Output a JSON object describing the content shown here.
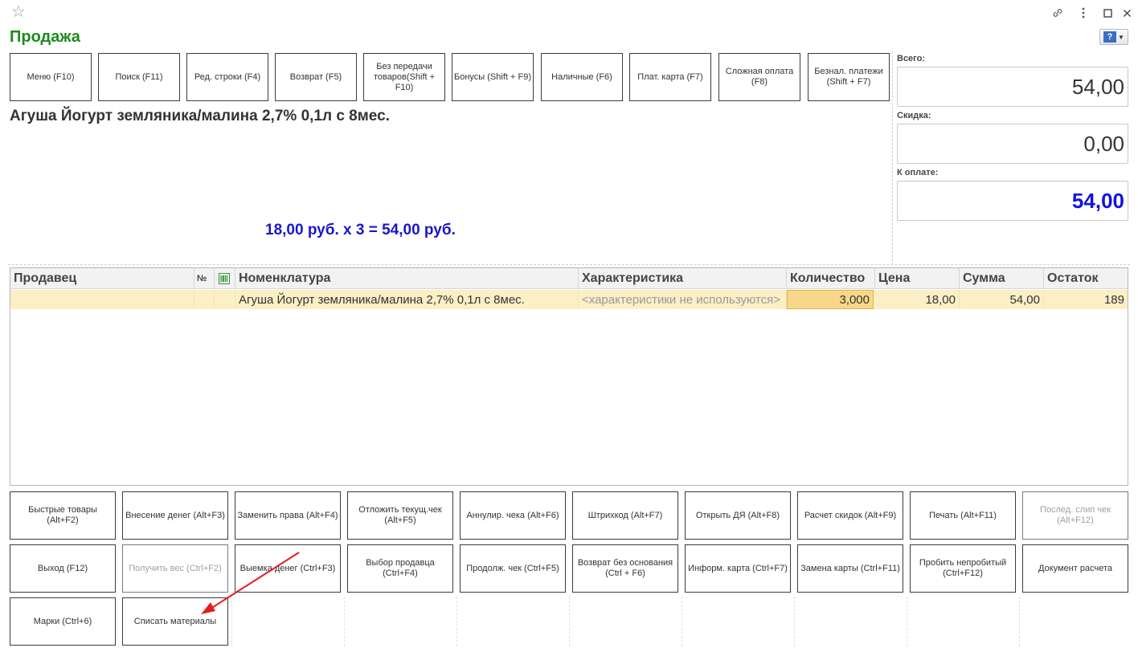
{
  "window": {
    "title": "Продажа"
  },
  "top_buttons": [
    "Меню (F10)",
    "Поиск (F11)",
    "Ред. строки (F4)",
    "Возврат (F5)",
    "Без передачи товаров(Shift + F10)",
    "Бонусы (Shift + F9)",
    "Наличные (F6)",
    "Плат. карта (F7)",
    "Сложная оплата (F8)",
    "Безнал. платежи (Shift + F7)"
  ],
  "totals": {
    "total_label": "Всего:",
    "total_value": "54,00",
    "discount_label": "Скидка:",
    "discount_value": "0,00",
    "pay_label": "К оплате:",
    "pay_value": "54,00"
  },
  "current_item": {
    "name": "Агуша Йогурт земляника/малина 2,7% 0,1л с 8мес.",
    "calc": "18,00 руб. x 3  = 54,00 руб."
  },
  "table": {
    "headers": [
      "Продавец",
      "№",
      "",
      "Номенклатура",
      "Характеристика",
      "Количество",
      "Цена",
      "Сумма",
      "Остаток"
    ],
    "rows": [
      {
        "seller": "",
        "num": "",
        "mark": "",
        "item": "Агуша Йогурт земляника/малина 2,7% 0,1л с 8мес.",
        "characteristic": "<характеристики не используются>",
        "qty": "3,000",
        "price": "18,00",
        "sum": "54,00",
        "stock": "189"
      }
    ]
  },
  "bottom_buttons": {
    "row1": [
      "Быстрые товары (Alt+F2)",
      "Внесение денег (Alt+F3)",
      "Заменить права (Alt+F4)",
      "Отложить текущ.чек (Alt+F5)",
      "Аннулир. чека (Alt+F6)",
      "Штрихкод (Alt+F7)",
      "Открыть ДЯ (Alt+F8)",
      "Расчет скидок (Alt+F9)",
      "Печать (Alt+F11)",
      "Послед. слип чек (Alt+F12)"
    ],
    "row2": [
      "Выход (F12)",
      "Получить вес (Ctrl+F2)",
      "Выемка денег (Ctrl+F3)",
      "Выбор продавца (Ctrl+F4)",
      "Продолж. чек (Ctrl+F5)",
      "Возврат без основания (Ctrl + F6)",
      "Информ. карта (Ctrl+F7)",
      "Замена карты (Ctrl+F11)",
      "Пробить непробитый (Ctrl+F12)",
      "Документ расчета"
    ],
    "row3": [
      "Марки (Ctrl+6)",
      "Списать материалы"
    ]
  },
  "colors": {
    "title": "#1e8a1e",
    "pay_value": "#1212e0",
    "calc_text": "#1717c8",
    "row_highlight": "#fbefc6",
    "annotation_arrow": "#e02020"
  }
}
